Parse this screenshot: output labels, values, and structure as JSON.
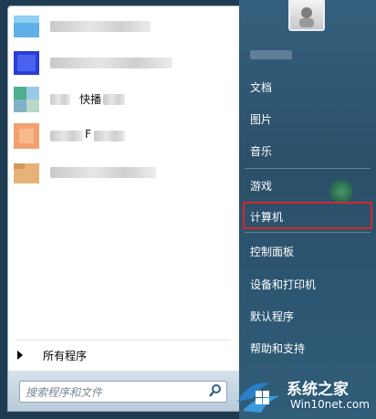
{
  "start_menu": {
    "pinned_programs": [
      {
        "label": "",
        "icon": "blue-app-icon"
      },
      {
        "label": "",
        "icon": "blue-window-icon"
      },
      {
        "label": "快播",
        "icon": "colorful-app-icon"
      },
      {
        "label": "F",
        "icon": "orange-app-icon"
      },
      {
        "label": "",
        "icon": "folder-app-icon"
      }
    ],
    "all_programs_label": "所有程序",
    "search": {
      "placeholder": "搜索程序和文件"
    },
    "right_items": [
      {
        "label": "文档"
      },
      {
        "label": "图片"
      },
      {
        "label": "音乐"
      },
      {
        "label": "游戏"
      },
      {
        "label": "计算机"
      },
      {
        "label": "控制面板"
      },
      {
        "label": "设备和打印机"
      },
      {
        "label": "默认程序"
      },
      {
        "label": "帮助和支持"
      }
    ],
    "highlighted_item": "计算机",
    "colors": {
      "right_panel": "#2b4f69",
      "highlight": "#d42a2a",
      "search_border": "#8ea3b7"
    }
  },
  "watermark": {
    "title": "系统之家",
    "url": "Win10net.com"
  }
}
